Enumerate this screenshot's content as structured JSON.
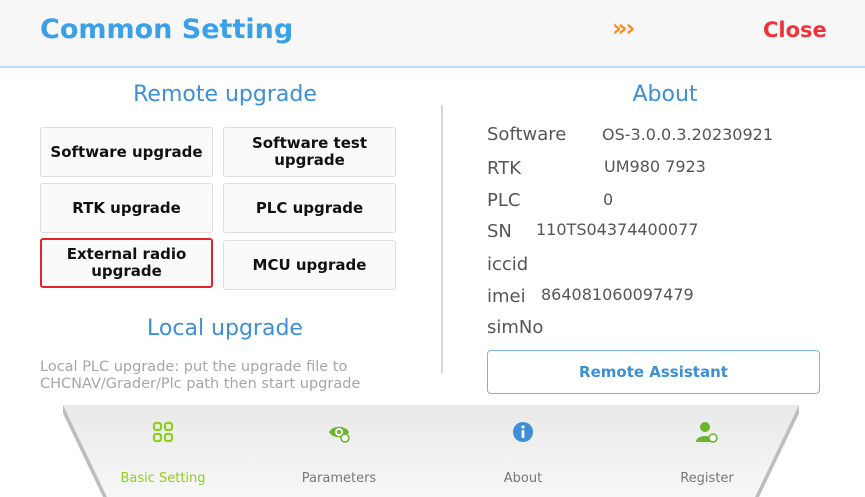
{
  "header": {
    "title": "Common Setting",
    "chevrons": "»›",
    "close_label": "Close"
  },
  "remote_upgrade": {
    "title": "Remote upgrade",
    "buttons": [
      {
        "label": "Software upgrade",
        "selected": false
      },
      {
        "label": "Software test upgrade",
        "selected": false
      },
      {
        "label": "RTK upgrade",
        "selected": false
      },
      {
        "label": "PLC upgrade",
        "selected": false
      },
      {
        "label": "External radio upgrade",
        "selected": true
      },
      {
        "label": "MCU upgrade",
        "selected": false
      }
    ]
  },
  "local_upgrade": {
    "title": "Local upgrade",
    "description": "Local PLC upgrade: put the upgrade file to CHCNAV/Grader/Plc path then start upgrade"
  },
  "about": {
    "title": "About",
    "rows": [
      {
        "key": "Software",
        "value": "OS-3.0.0.3.20230921"
      },
      {
        "key": "RTK",
        "value": "UM980 7923"
      },
      {
        "key": "PLC",
        "value": "0"
      },
      {
        "key": "SN",
        "value": "110TS04374400077"
      },
      {
        "key": "iccid",
        "value": ""
      },
      {
        "key": "imei",
        "value": "864081060097479"
      },
      {
        "key": "simNo",
        "value": ""
      }
    ],
    "remote_assistant_label": "Remote Assistant"
  },
  "navbar": {
    "items": [
      {
        "label": "Basic Setting",
        "icon": "grid-icon",
        "active": true
      },
      {
        "label": "Parameters",
        "icon": "eye-settings-icon",
        "active": false
      },
      {
        "label": "About",
        "icon": "info-icon",
        "active": false
      },
      {
        "label": "Register",
        "icon": "user-icon",
        "active": false
      }
    ]
  },
  "colors": {
    "accent_blue": "#3aa0e8",
    "close_red": "#f0323a",
    "chevron_orange": "#ff8a1f",
    "selected_border": "#e5232a",
    "nav_green": "#8fcf1f"
  }
}
